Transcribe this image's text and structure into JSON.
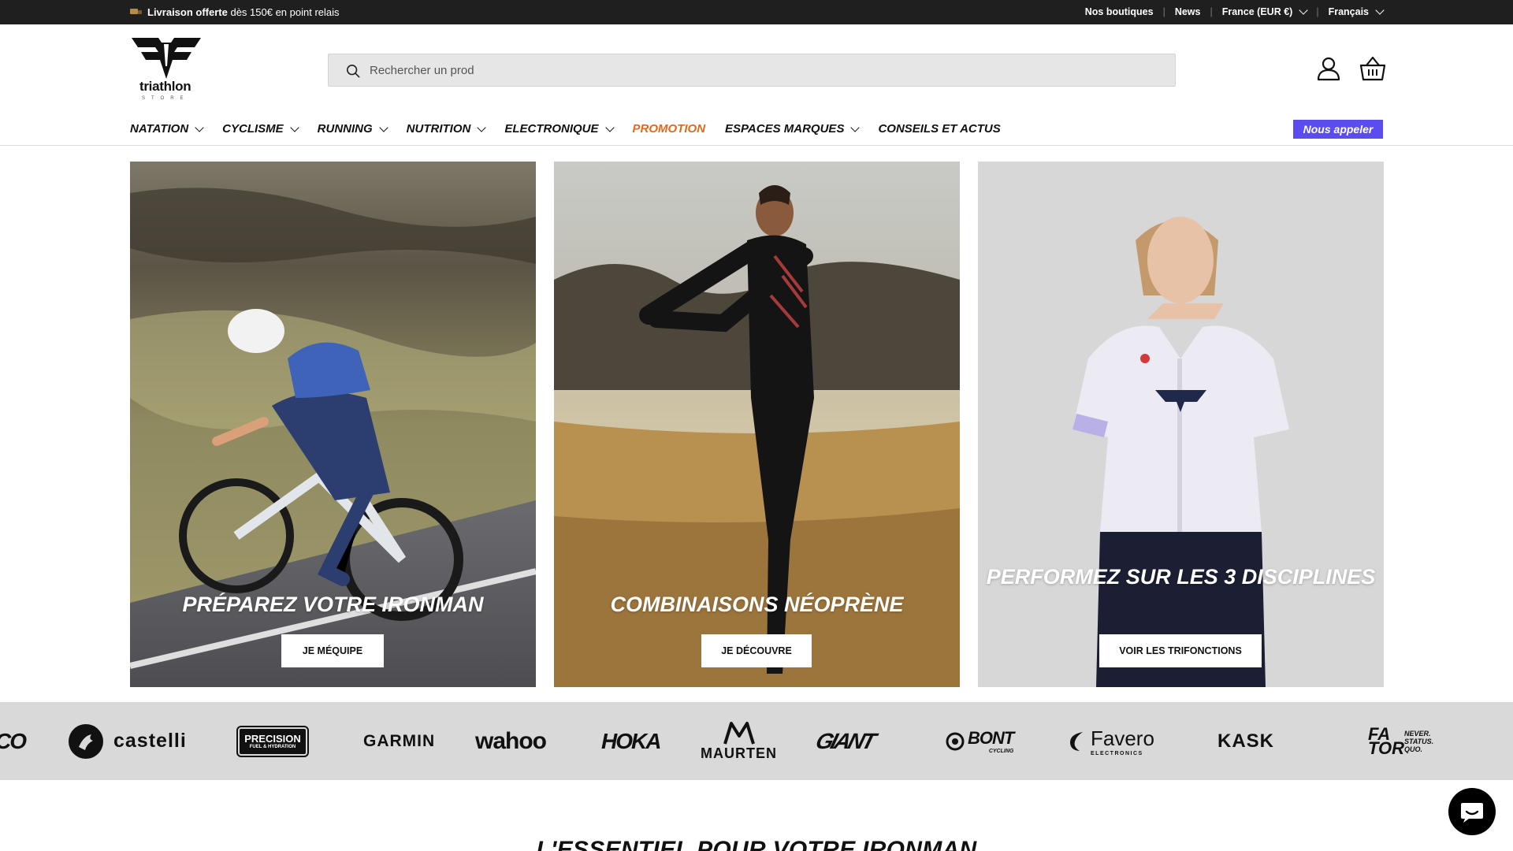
{
  "announcement": {
    "promo_bold": "Livraison offerte",
    "promo_text": " dès 150€ en point relais",
    "links": [
      "Nos boutiques",
      "News"
    ],
    "country": "France (EUR €)",
    "language": "Français"
  },
  "header": {
    "logo_word": "triathlon",
    "logo_sub": "STORE",
    "search_placeholder": "Rechercher un prod"
  },
  "nav": {
    "items": [
      {
        "label": "NATATION",
        "dropdown": true
      },
      {
        "label": "CYCLISME",
        "dropdown": true
      },
      {
        "label": "RUNNING",
        "dropdown": true
      },
      {
        "label": "NUTRITION",
        "dropdown": true
      },
      {
        "label": "ELECTRONIQUE",
        "dropdown": true
      },
      {
        "label": "PROMOTION",
        "dropdown": false
      },
      {
        "label": "ESPACES MARQUES",
        "dropdown": true
      },
      {
        "label": "CONSEILS ET ACTUS",
        "dropdown": false
      }
    ],
    "call_label": "Nous appeler",
    "promo_color": "#e06a1b",
    "call_color": "#5b4cf0"
  },
  "hero": [
    {
      "title": "PRÉPAREZ VOTRE IRONMAN",
      "button": "JE MÉQUIPE"
    },
    {
      "title": "COMBINAISONS NÉOPRÈNE",
      "button": "JE DÉCOUVRE"
    },
    {
      "title": "PERFORMEZ SUR LES 3 DISCIPLINES",
      "button": "VOIR LES TRIFONCTIONS"
    }
  ],
  "brands": {
    "partial_left": "CO",
    "castelli": "castelli",
    "precision_line1": "PRECISION",
    "precision_line2": "FUEL & HYDRATION",
    "garmin": "GARMIN",
    "wahoo": "wahoo",
    "hoka": "HOKA",
    "maurten": "MAURTEN",
    "giant": "GIANT",
    "bont_main": "BONT",
    "bont_sub": "CYCLING",
    "favero_main": "Favero",
    "favero_sub": "ELECTRONICS",
    "kask": "KASK",
    "factor_main": "FA TOR",
    "factor_tag": "NEVER. STATUS. QUO."
  },
  "section_title": "L'ESSENTIEL POUR VOTRE IRONMAN"
}
